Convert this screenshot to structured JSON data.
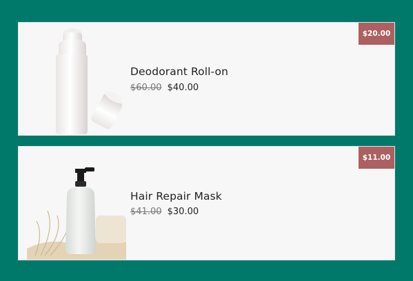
{
  "products": [
    {
      "name": "Deodorant Roll-on",
      "old_price": "$60.00",
      "price": "$40.00",
      "badge": "$20.00",
      "image_icon": "roll-on-bottle"
    },
    {
      "name": "Hair Repair Mask",
      "old_price": "$41.00",
      "price": "$30.00",
      "badge": "$11.00",
      "image_icon": "pump-bottle"
    }
  ],
  "colors": {
    "background": "#00796b",
    "card": "#f7f7f7",
    "badge": "#ac6060"
  }
}
